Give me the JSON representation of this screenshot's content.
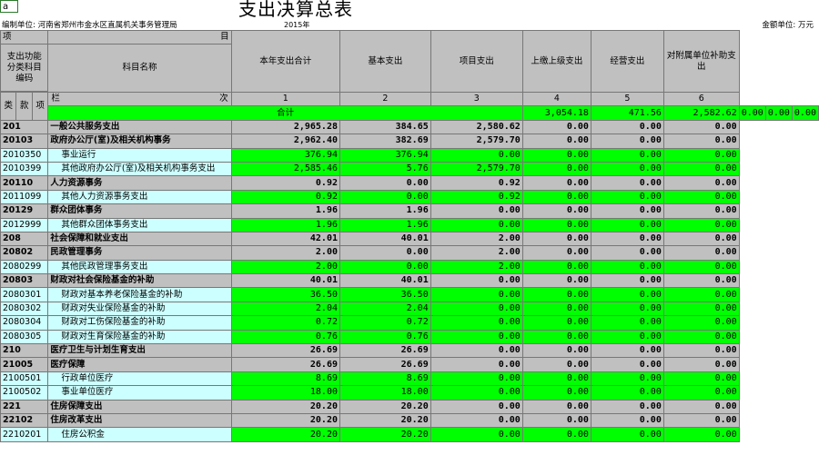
{
  "sheet": {
    "cell_ref": "a",
    "title": "支出决算总表",
    "unit_left": "编制单位: 河南省郑州市金水区直属机关事务管理局",
    "year": "2015年",
    "unit_right": "金额单位: 万元"
  },
  "headers": {
    "xiang": "项",
    "mu": "目",
    "code_header": "支出功能分类科目编码",
    "name_header": "科目名称",
    "lan": "栏",
    "ci": "次",
    "lei": "类",
    "kuan": "款",
    "xiang2": "项",
    "columns": [
      {
        "label": "本年支出合计",
        "num": "1"
      },
      {
        "label": "基本支出",
        "num": "2"
      },
      {
        "label": "项目支出",
        "num": "3"
      },
      {
        "label": "上缴上级支出",
        "num": "4"
      },
      {
        "label": "经营支出",
        "num": "5"
      },
      {
        "label": "对附属单位补助支出",
        "num": "6"
      }
    ]
  },
  "total": {
    "label": "合计",
    "values": [
      "3,054.18",
      "471.56",
      "2,582.62",
      "0.00",
      "0.00",
      "0.00"
    ]
  },
  "rows": [
    {
      "code": "201",
      "name": "一般公共服务支出",
      "level": 1,
      "values": [
        "2,965.28",
        "384.65",
        "2,580.62",
        "0.00",
        "0.00",
        "0.00"
      ]
    },
    {
      "code": "20103",
      "name": "政府办公厅(室)及相关机构事务",
      "level": 2,
      "values": [
        "2,962.40",
        "382.69",
        "2,579.70",
        "0.00",
        "0.00",
        "0.00"
      ]
    },
    {
      "code": "2010350",
      "name": "事业运行",
      "level": 3,
      "values": [
        "376.94",
        "376.94",
        "0.00",
        "0.00",
        "0.00",
        "0.00"
      ]
    },
    {
      "code": "2010399",
      "name": "其他政府办公厅(室)及相关机构事务支出",
      "level": 3,
      "values": [
        "2,585.46",
        "5.76",
        "2,579.70",
        "0.00",
        "0.00",
        "0.00"
      ]
    },
    {
      "code": "20110",
      "name": "人力资源事务",
      "level": 2,
      "values": [
        "0.92",
        "0.00",
        "0.92",
        "0.00",
        "0.00",
        "0.00"
      ]
    },
    {
      "code": "2011099",
      "name": "其他人力资源事务支出",
      "level": 3,
      "values": [
        "0.92",
        "0.00",
        "0.92",
        "0.00",
        "0.00",
        "0.00"
      ]
    },
    {
      "code": "20129",
      "name": "群众团体事务",
      "level": 2,
      "values": [
        "1.96",
        "1.96",
        "0.00",
        "0.00",
        "0.00",
        "0.00"
      ]
    },
    {
      "code": "2012999",
      "name": "其他群众团体事务支出",
      "level": 3,
      "values": [
        "1.96",
        "1.96",
        "0.00",
        "0.00",
        "0.00",
        "0.00"
      ]
    },
    {
      "code": "208",
      "name": "社会保障和就业支出",
      "level": 1,
      "values": [
        "42.01",
        "40.01",
        "2.00",
        "0.00",
        "0.00",
        "0.00"
      ]
    },
    {
      "code": "20802",
      "name": "民政管理事务",
      "level": 2,
      "values": [
        "2.00",
        "0.00",
        "2.00",
        "0.00",
        "0.00",
        "0.00"
      ]
    },
    {
      "code": "2080299",
      "name": "其他民政管理事务支出",
      "level": 3,
      "values": [
        "2.00",
        "0.00",
        "2.00",
        "0.00",
        "0.00",
        "0.00"
      ]
    },
    {
      "code": "20803",
      "name": "财政对社会保险基金的补助",
      "level": 2,
      "values": [
        "40.01",
        "40.01",
        "0.00",
        "0.00",
        "0.00",
        "0.00"
      ]
    },
    {
      "code": "2080301",
      "name": "财政对基本养老保险基金的补助",
      "level": 3,
      "values": [
        "36.50",
        "36.50",
        "0.00",
        "0.00",
        "0.00",
        "0.00"
      ]
    },
    {
      "code": "2080302",
      "name": "财政对失业保险基金的补助",
      "level": 3,
      "values": [
        "2.04",
        "2.04",
        "0.00",
        "0.00",
        "0.00",
        "0.00"
      ]
    },
    {
      "code": "2080304",
      "name": "财政对工伤保险基金的补助",
      "level": 3,
      "values": [
        "0.72",
        "0.72",
        "0.00",
        "0.00",
        "0.00",
        "0.00"
      ]
    },
    {
      "code": "2080305",
      "name": "财政对生育保险基金的补助",
      "level": 3,
      "values": [
        "0.76",
        "0.76",
        "0.00",
        "0.00",
        "0.00",
        "0.00"
      ]
    },
    {
      "code": "210",
      "name": "医疗卫生与计划生育支出",
      "level": 1,
      "values": [
        "26.69",
        "26.69",
        "0.00",
        "0.00",
        "0.00",
        "0.00"
      ]
    },
    {
      "code": "21005",
      "name": "医疗保障",
      "level": 2,
      "values": [
        "26.69",
        "26.69",
        "0.00",
        "0.00",
        "0.00",
        "0.00"
      ]
    },
    {
      "code": "2100501",
      "name": "行政单位医疗",
      "level": 3,
      "values": [
        "8.69",
        "8.69",
        "0.00",
        "0.00",
        "0.00",
        "0.00"
      ]
    },
    {
      "code": "2100502",
      "name": "事业单位医疗",
      "level": 3,
      "values": [
        "18.00",
        "18.00",
        "0.00",
        "0.00",
        "0.00",
        "0.00"
      ]
    },
    {
      "code": "221",
      "name": "住房保障支出",
      "level": 1,
      "values": [
        "20.20",
        "20.20",
        "0.00",
        "0.00",
        "0.00",
        "0.00"
      ]
    },
    {
      "code": "22102",
      "name": "住房改革支出",
      "level": 2,
      "values": [
        "20.20",
        "20.20",
        "0.00",
        "0.00",
        "0.00",
        "0.00"
      ]
    },
    {
      "code": "2210201",
      "name": "住房公积金",
      "level": 3,
      "values": [
        "20.20",
        "20.20",
        "0.00",
        "0.00",
        "0.00",
        "0.00"
      ]
    }
  ]
}
